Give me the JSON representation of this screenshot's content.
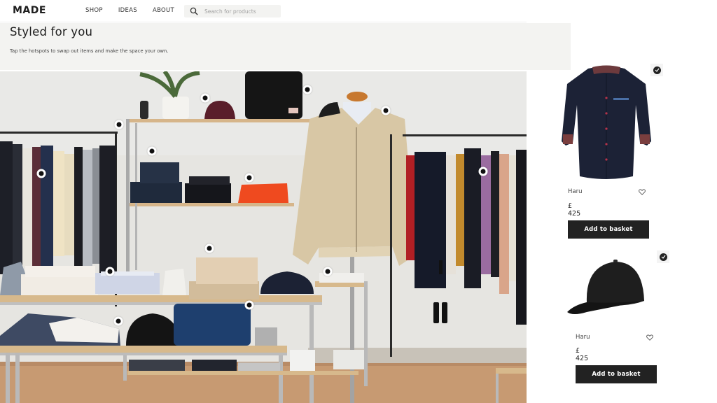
{
  "header": {
    "logo": "MADE",
    "nav": [
      {
        "label": "SHOP"
      },
      {
        "label": "IDEAS"
      },
      {
        "label": "ABOUT"
      }
    ],
    "search": {
      "placeholder": "Search for products",
      "value": "",
      "icon": "search-icon"
    }
  },
  "banner": {
    "title": "Styled for you",
    "subtitle": "Tap the hotspots to swap out items and make the space your own."
  },
  "scene": {
    "description": "Clothing store interior with rails, shelves and mannequin",
    "hotspot_count": 13,
    "hotspot_targets": [
      "rail-left",
      "shirt-on-rail",
      "jeans-stack",
      "burgundy-cap",
      "orange-sweater",
      "backpack",
      "beige-jacket",
      "purple-shirt-right-rail",
      "chino-stack",
      "striped-shirts",
      "white-folded-shirt",
      "blue-shorts",
      "book"
    ]
  },
  "products": [
    {
      "name": "Haru",
      "price": "£ 425",
      "button_label": "Add to basket",
      "image": "navy-button-shirt",
      "selected": true,
      "colors": {
        "body": "#1c2236",
        "accent": "#8a3a3a"
      }
    },
    {
      "name": "Haru",
      "price": "£ 425",
      "button_label": "Add to basket",
      "image": "black-baseball-cap",
      "selected": true,
      "colors": {
        "body": "#1b1b1b"
      }
    }
  ],
  "colors": {
    "button_bg": "#222222",
    "banner_bg": "#f3f3f1",
    "text": "#1e1e1e"
  }
}
